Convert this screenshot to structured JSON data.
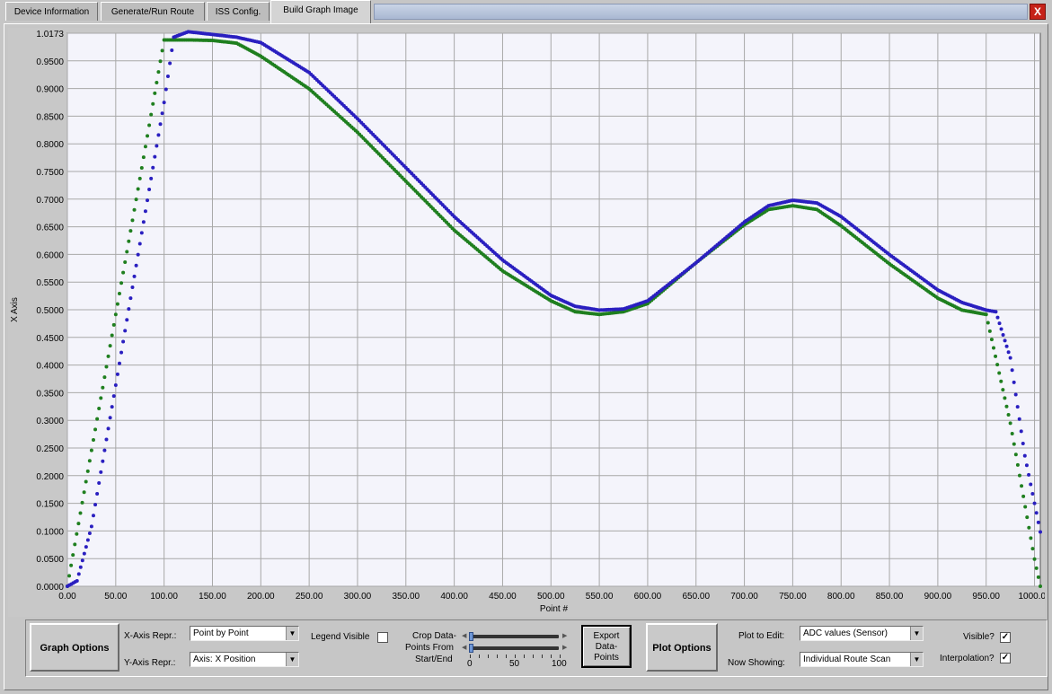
{
  "tabs": [
    {
      "label": "Device Information",
      "active": false
    },
    {
      "label": "Generate/Run Route",
      "active": false
    },
    {
      "label": "ISS Config.",
      "active": false
    },
    {
      "label": "Build Graph Image",
      "active": true
    }
  ],
  "window": {
    "close_label": "X"
  },
  "chart_data": {
    "type": "scatter",
    "xlabel": "Point #",
    "ylabel": "X Axis",
    "xlim": [
      0,
      1006
    ],
    "ylim": [
      0,
      1.0173
    ],
    "grid": true,
    "x_ticks": [
      "0.00",
      "50.00",
      "100.00",
      "150.00",
      "200.00",
      "250.00",
      "300.00",
      "350.00",
      "400.00",
      "450.00",
      "500.00",
      "550.00",
      "600.00",
      "650.00",
      "700.00",
      "750.00",
      "800.00",
      "850.00",
      "900.00",
      "950.00",
      "1000.00"
    ],
    "y_ticks": [
      "0.0000",
      "0.0500",
      "0.1000",
      "0.1500",
      "0.2000",
      "0.2500",
      "0.3000",
      "0.3500",
      "0.4000",
      "0.4500",
      "0.5000",
      "0.5500",
      "0.6000",
      "0.6500",
      "0.7000",
      "0.7500",
      "0.8000",
      "0.8500",
      "0.9000",
      "0.9500",
      "1.0173"
    ],
    "series": [
      {
        "color": "#1f7f1f",
        "marker": "dot",
        "x": [
          0,
          25,
          50,
          75,
          100,
          125,
          150,
          175,
          200,
          250,
          300,
          350,
          400,
          450,
          500,
          525,
          550,
          575,
          600,
          650,
          700,
          725,
          750,
          775,
          800,
          850,
          900,
          925,
          950,
          975,
          1000,
          1006
        ],
        "y": [
          0,
          0.25,
          0.5,
          0.75,
          1.005,
          1.005,
          1.004,
          0.999,
          0.975,
          0.915,
          0.835,
          0.745,
          0.655,
          0.58,
          0.525,
          0.505,
          0.5,
          0.505,
          0.52,
          0.595,
          0.665,
          0.693,
          0.7,
          0.693,
          0.663,
          0.593,
          0.53,
          0.508,
          0.5,
          0.3,
          0.05,
          0
        ]
      },
      {
        "color": "#2a1fc0",
        "marker": "dot",
        "x": [
          0,
          10,
          25,
          50,
          75,
          100,
          110,
          125,
          150,
          175,
          200,
          250,
          300,
          350,
          400,
          450,
          500,
          525,
          550,
          575,
          600,
          650,
          700,
          725,
          750,
          775,
          800,
          850,
          900,
          925,
          950,
          960,
          975,
          990,
          1006
        ],
        "y": [
          0,
          0.01,
          0.11,
          0.37,
          0.63,
          0.89,
          1.01,
          1.02,
          1.015,
          1.01,
          1.0,
          0.945,
          0.86,
          0.77,
          0.68,
          0.6,
          0.535,
          0.515,
          0.508,
          0.51,
          0.525,
          0.595,
          0.67,
          0.7,
          0.71,
          0.705,
          0.68,
          0.61,
          0.545,
          0.522,
          0.508,
          0.505,
          0.42,
          0.24,
          0.1
        ]
      }
    ]
  },
  "graph_options": {
    "title": "Graph Options",
    "x_axis_label": "X-Axis Repr.:",
    "x_axis_value": "Point by Point",
    "y_axis_label": "Y-Axis Repr.:",
    "y_axis_value": "Axis: X Position",
    "legend_label": "Legend Visible",
    "legend_checked": false,
    "crop_label_1": "Crop Data-",
    "crop_label_2": "Points From",
    "crop_label_3": "Start/End",
    "scale": [
      "0",
      "50",
      "100"
    ],
    "export_label_1": "Export",
    "export_label_2": "Data-",
    "export_label_3": "Points"
  },
  "plot_options": {
    "title": "Plot Options",
    "plot_edit_label": "Plot to Edit:",
    "plot_edit_value": "ADC values (Sensor)",
    "showing_label": "Now Showing:",
    "showing_value": "Individual Route Scan",
    "visible_label": "Visible?",
    "visible_checked": "✓",
    "interp_label": "Interpolation?",
    "interp_checked": "✓"
  },
  "icons": {
    "dropdown": "chevron-down-icon",
    "check": "check-icon"
  }
}
